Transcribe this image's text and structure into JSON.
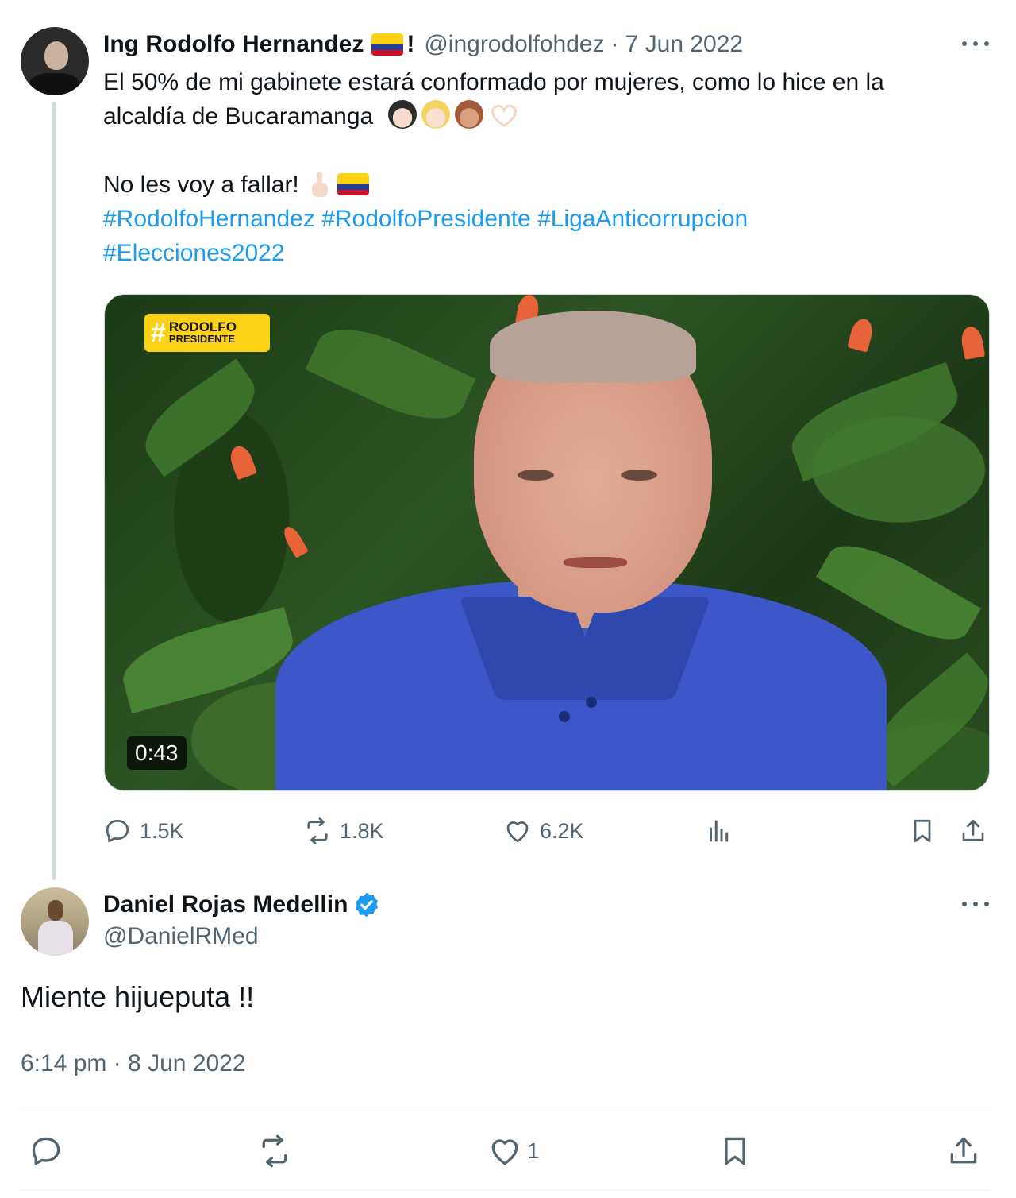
{
  "parent_tweet": {
    "author_name": "Ing Rodolfo Hernandez",
    "author_suffix": "!",
    "handle": "@ingrodolfohdez",
    "separator": "·",
    "date": "7 Jun 2022",
    "text_line1": "El 50% de mi gabinete estará conformado por mujeres, como lo hice en la",
    "text_line2": "alcaldía de Bucaramanga",
    "text_line3": "No les voy a fallar!",
    "hashtags": [
      "#RodolfoHernandez",
      "#RodolfoPresidente",
      "#LigaAnticorrupcion",
      "#Elecciones2022"
    ],
    "media": {
      "badge_hash": "#",
      "badge_line1": "RODOLFO",
      "badge_line2": "PRESIDENTE",
      "duration": "0:43"
    },
    "stats": {
      "replies": "1.5K",
      "reposts": "1.8K",
      "likes": "6.2K"
    },
    "icons": [
      "more-icon",
      "reply-icon",
      "repost-icon",
      "like-icon",
      "views-icon",
      "bookmark-icon",
      "share-icon"
    ]
  },
  "reply_tweet": {
    "author_name": "Daniel Rojas Medellin",
    "verified": true,
    "handle": "@DanielRMed",
    "text": "Miente hijueputa !!",
    "timestamp": "6:14 pm · 8 Jun 2022",
    "stats": {
      "likes": "1"
    },
    "icons": [
      "verified-badge-icon",
      "more-icon",
      "reply-icon",
      "repost-icon",
      "like-icon",
      "bookmark-icon",
      "share-icon"
    ]
  },
  "colors": {
    "link": "#1d9bf0",
    "text": "#0f1419",
    "secondary": "#536471",
    "verified": "#1d9bf0",
    "divider": "#eff3f4"
  }
}
